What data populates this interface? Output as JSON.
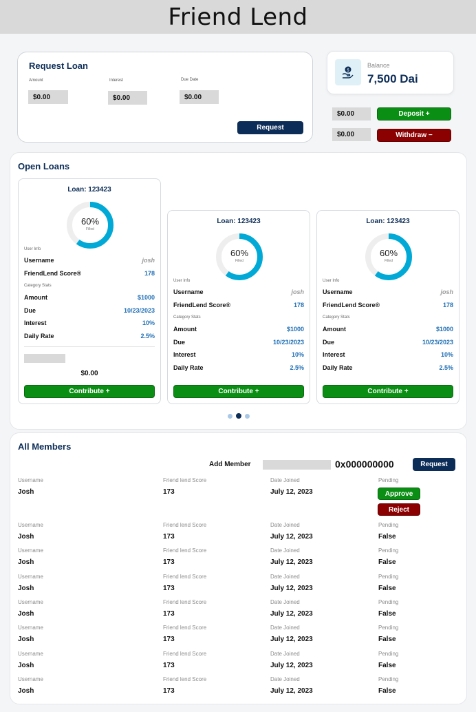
{
  "app": {
    "title": "Friend Lend"
  },
  "request_loan": {
    "title": "Request Loan",
    "amount_label": "Amount",
    "interest_label": "Interest",
    "due_date_label": "Due Date",
    "amount_value": "$0.00",
    "interest_value": "$0.00",
    "due_date_value": "$0.00",
    "request_button": "Request"
  },
  "balance": {
    "label": "Balance",
    "value": "7,500 Dai",
    "deposit_value": "$0.00",
    "deposit_button": "Deposit +",
    "withdraw_value": "$0.00",
    "withdraw_button": "Withdraw −"
  },
  "open_loans": {
    "title": "Open Loans",
    "loans": [
      {
        "title": "Loan: 123423",
        "percent": "60%",
        "percent_value": 60,
        "filled_label": "Filled",
        "user_info_label": "User Info",
        "username_label": "Username",
        "username": "josh",
        "score_label": "FriendLend Score®",
        "score": "178",
        "category_label": "Category Stats",
        "amount_label": "Amount",
        "amount": "$1000",
        "due_label": "Due",
        "due": "10/23/2023",
        "interest_label": "Interest",
        "interest": "10%",
        "daily_rate_label": "Daily Rate",
        "daily_rate": "2.5%",
        "contribution_value": "$0.00",
        "contribute_button": "Contribute +"
      },
      {
        "title": "Loan: 123423",
        "percent": "60%",
        "percent_value": 60,
        "filled_label": "Filled",
        "user_info_label": "User Info",
        "username_label": "Username",
        "username": "josh",
        "score_label": "FriendLend Score®",
        "score": "178",
        "category_label": "Category Stats",
        "amount_label": "Amount",
        "amount": "$1000",
        "due_label": "Due",
        "due": "10/23/2023",
        "interest_label": "Interest",
        "interest": "10%",
        "daily_rate_label": "Daily Rate",
        "daily_rate": "2.5%",
        "contribute_button": "Contribute +"
      },
      {
        "title": "Loan: 123423",
        "percent": "60%",
        "percent_value": 60,
        "filled_label": "Filled",
        "user_info_label": "User Info",
        "username_label": "Username",
        "username": "josh",
        "score_label": "FriendLend Score®",
        "score": "178",
        "category_label": "Category Stats",
        "amount_label": "Amount",
        "amount": "$1000",
        "due_label": "Due",
        "due": "10/23/2023",
        "interest_label": "Interest",
        "interest": "10%",
        "daily_rate_label": "Daily Rate",
        "daily_rate": "2.5%",
        "contribute_button": "Contribute +"
      }
    ]
  },
  "members": {
    "title": "All Members",
    "add_member_label": "Add Member",
    "address": "0x000000000",
    "request_button": "Request",
    "columns": {
      "username": "Username",
      "score": "Friend lend Score",
      "joined": "Date Joined",
      "pending": "Pending"
    },
    "approve_button": "Approve",
    "reject_button": "Reject",
    "rows": [
      {
        "username": "Josh",
        "score": "173",
        "joined": "July 12, 2023",
        "pending": ""
      },
      {
        "username": "Josh",
        "score": "173",
        "joined": "July 12, 2023",
        "pending": "False"
      },
      {
        "username": "Josh",
        "score": "173",
        "joined": "July 12, 2023",
        "pending": "False"
      },
      {
        "username": "Josh",
        "score": "173",
        "joined": "July 12, 2023",
        "pending": "False"
      },
      {
        "username": "Josh",
        "score": "173",
        "joined": "July 12, 2023",
        "pending": "False"
      },
      {
        "username": "Josh",
        "score": "173",
        "joined": "July 12, 2023",
        "pending": "False"
      },
      {
        "username": "Josh",
        "score": "173",
        "joined": "July 12, 2023",
        "pending": "False"
      },
      {
        "username": "Josh",
        "score": "173",
        "joined": "July 12, 2023",
        "pending": "False"
      }
    ]
  },
  "colors": {
    "navy": "#0c2d57",
    "green": "#0a8f14",
    "red": "#8b0000",
    "donut": "#00a9d6",
    "link_blue": "#1f6fb5"
  }
}
